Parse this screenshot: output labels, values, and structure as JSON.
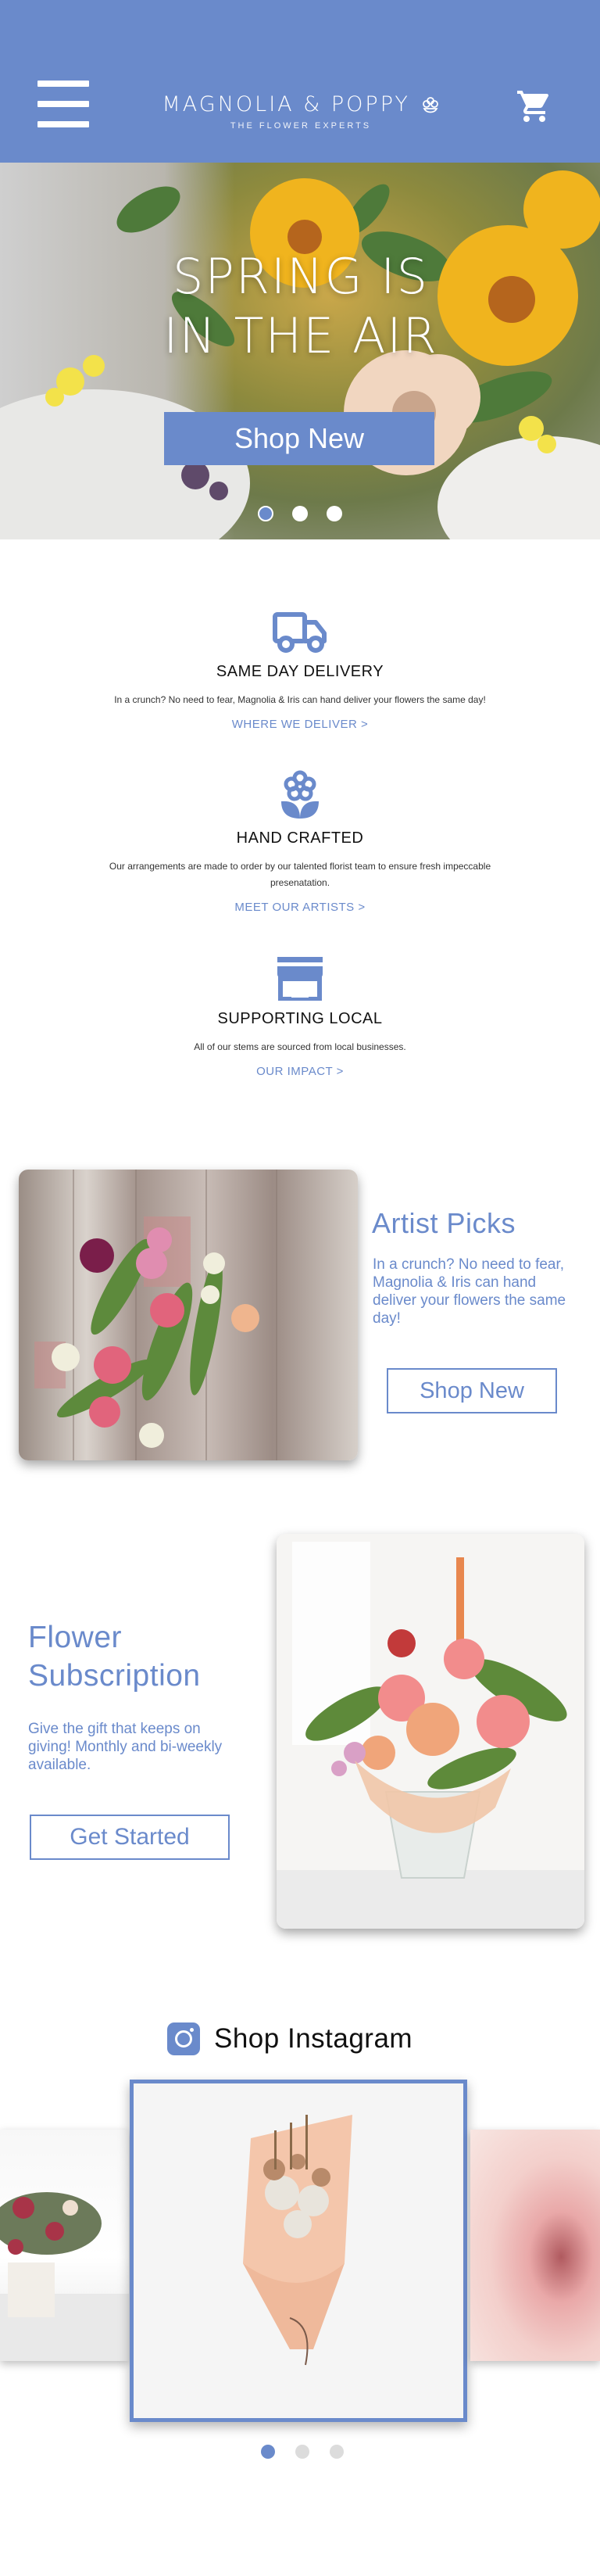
{
  "header": {
    "brand": "MAGNOLIA & POPPY",
    "tagline": "THE FLOWER EXPERTS",
    "menu_icon": "hamburger-menu-icon",
    "cart_icon": "shopping-cart-icon",
    "logo_icon": "flower-icon",
    "background_color": "#6a8acb"
  },
  "hero": {
    "title_line1": "SPRING IS",
    "title_line2": "IN THE AIR",
    "button_label": "Shop New",
    "slides": 3,
    "active_slide": 1
  },
  "features": [
    {
      "icon": "truck-icon",
      "title": "SAME DAY DELIVERY",
      "description": "In a crunch? No need to fear, Magnolia & Iris can hand deliver your flowers the same day!",
      "link": "WHERE WE DELIVER >"
    },
    {
      "icon": "flower-icon",
      "title": "HAND CRAFTED",
      "description": "Our arrangements are made to order by our talented florist team to ensure fresh impeccable presenatation.",
      "link": "MEET OUR ARTISTS >"
    },
    {
      "icon": "storefront-icon",
      "title": "SUPPORTING LOCAL",
      "description": "All of our stems are sourced from local businesses.",
      "link": "OUR IMPACT >"
    }
  ],
  "artist_picks": {
    "title": "Artist Picks",
    "description": "In a crunch? No need to fear, Magnolia & Iris can hand deliver your flowers the same day!",
    "button_label": "Shop New"
  },
  "subscription": {
    "title": "Flower Subscription",
    "description": "Give the gift that keeps on giving! Monthly and bi-weekly available.",
    "button_label": "Get Started"
  },
  "instagram": {
    "icon": "instagram-icon",
    "title": "Shop Instagram",
    "slides": 3,
    "active_slide": 1
  },
  "colors": {
    "accent": "#6a8acb",
    "text": "#111111"
  }
}
